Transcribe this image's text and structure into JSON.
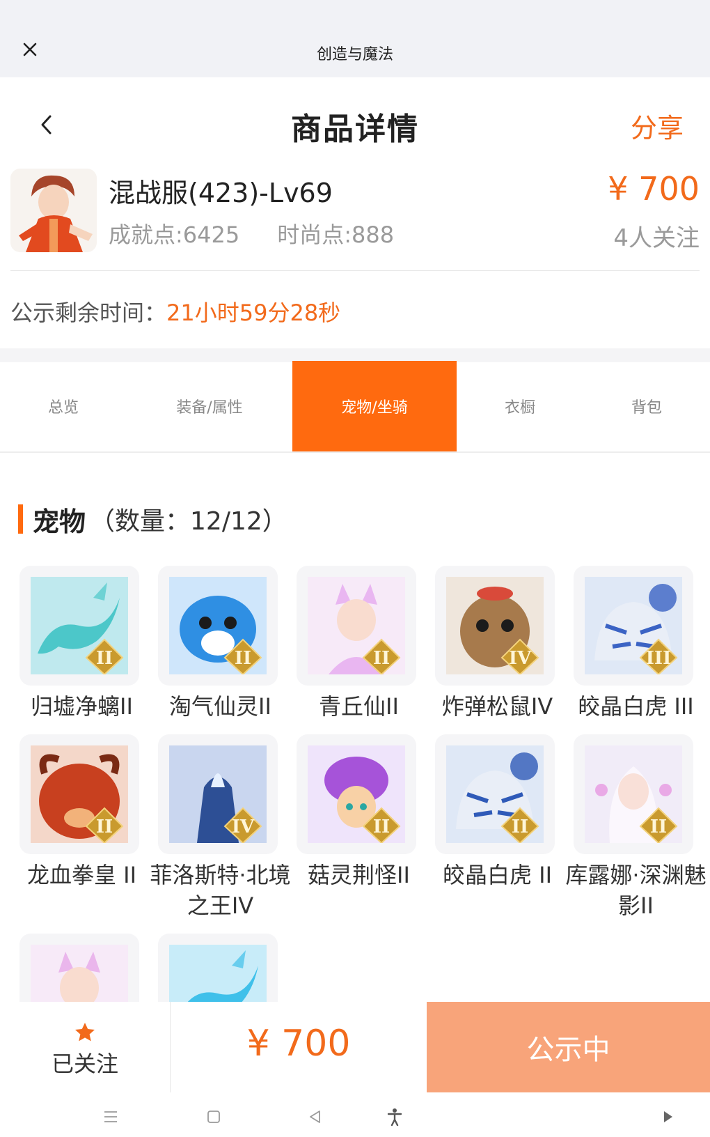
{
  "appbar": {
    "title": "创造与魔法",
    "close_icon": "close-icon"
  },
  "header": {
    "title": "商品详情",
    "share": "分享"
  },
  "product": {
    "name": "混战服(423)-Lv69",
    "achievement": "成就点:6425",
    "fashion": "时尚点:888",
    "price": "¥ 700",
    "followers": "4人关注"
  },
  "timer": {
    "label": "公示剩余时间：",
    "value": "21小时59分28秒"
  },
  "tabs": [
    {
      "label": "总览",
      "active": false
    },
    {
      "label": "装备/属性",
      "active": false
    },
    {
      "label": "宠物/坐骑",
      "active": true
    },
    {
      "label": "衣橱",
      "active": false
    },
    {
      "label": "背包",
      "active": false
    }
  ],
  "section": {
    "title": "宠物",
    "count": "（数量：12/12）"
  },
  "pets": [
    {
      "name": "归墟净螭II",
      "icon": "cyan-dragon",
      "colors": [
        "#bfe9ee",
        "#4cc7c9"
      ],
      "tier": "II"
    },
    {
      "name": "淘气仙灵II",
      "icon": "blue-puppy",
      "colors": [
        "#cfe6fb",
        "#2f8fe3"
      ],
      "tier": "II"
    },
    {
      "name": "青丘仙II",
      "icon": "fox-girl",
      "colors": [
        "#f7eaf8",
        "#e9b6f1"
      ],
      "tier": "II"
    },
    {
      "name": "炸弹松鼠IV",
      "icon": "squirrel",
      "colors": [
        "#efe6dc",
        "#a77a4c"
      ],
      "tier": "IV"
    },
    {
      "name": "皎晶白虎 III",
      "icon": "white-tiger",
      "colors": [
        "#dfe8f6",
        "#3b63c4"
      ],
      "tier": "III"
    },
    {
      "name": "龙血拳皇 II",
      "icon": "red-beast",
      "colors": [
        "#f4d7c9",
        "#c8401f"
      ],
      "tier": "II"
    },
    {
      "name": "菲洛斯特·北境之王IV",
      "icon": "frost-king",
      "colors": [
        "#c9d6ef",
        "#2d4f95"
      ],
      "tier": "IV"
    },
    {
      "name": "菇灵荆怪II",
      "icon": "mushroom-sprite",
      "colors": [
        "#efe4fb",
        "#a653d9"
      ],
      "tier": "II"
    },
    {
      "name": "皎晶白虎 II",
      "icon": "white-tiger",
      "colors": [
        "#dfe8f6",
        "#2f5ab8"
      ],
      "tier": "II"
    },
    {
      "name": "库露娜·深渊魅影II",
      "icon": "white-girl",
      "colors": [
        "#f1ecf8",
        "#e9a9e6"
      ],
      "tier": "II"
    },
    {
      "name": "",
      "icon": "fox-girl",
      "colors": [
        "#f7eaf8",
        "#eab6ec"
      ],
      "tier": ""
    },
    {
      "name": "",
      "icon": "cyan-dragon",
      "colors": [
        "#c8ecf9",
        "#3fc0ea"
      ],
      "tier": ""
    }
  ],
  "bottom": {
    "followed": "已关注",
    "price": "¥ 700",
    "status": "公示中"
  },
  "colors": {
    "accent": "#ff6a0f",
    "price": "#f26a1b",
    "status_button": "#f8a47a"
  }
}
